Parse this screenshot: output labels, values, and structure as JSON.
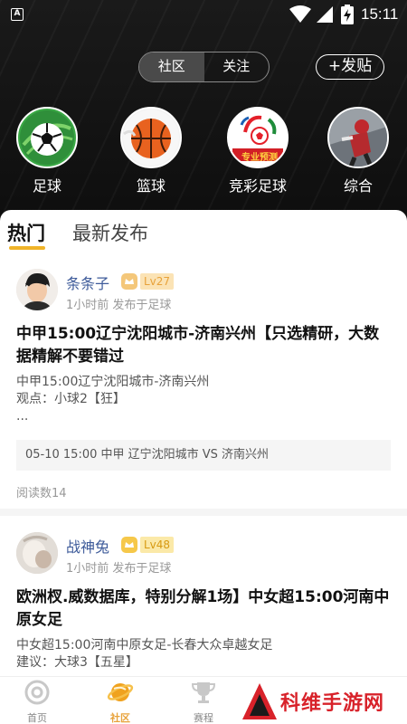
{
  "status_bar": {
    "app_icon_letter": "A",
    "time": "15:11",
    "icons": [
      "wifi-icon",
      "signal-icon",
      "battery-charging-icon"
    ]
  },
  "header": {
    "segment": {
      "tabs": [
        "社区",
        "关注"
      ],
      "active_index": 0
    },
    "post_button_label": "+发贴",
    "categories": [
      {
        "label": "足球",
        "icon": "football-icon"
      },
      {
        "label": "篮球",
        "icon": "basketball-icon"
      },
      {
        "label": "竞彩足球",
        "icon": "lottery-football-icon",
        "image_text": "专业预测"
      },
      {
        "label": "综合",
        "icon": "general-sports-icon"
      }
    ]
  },
  "feed": {
    "tabs": [
      "热门",
      "最新发布"
    ],
    "active_tab_index": 0,
    "posts": [
      {
        "author": "条条子",
        "level": "Lv27",
        "time": "1小时前 发布于足球",
        "title": "中甲15:00辽宁沈阳城市-济南兴州【只选精研，大数据精解不要错过",
        "body_lines": [
          "中甲15:00辽宁沈阳城市-济南兴州",
          "观点：小球2【狂】",
          "..."
        ],
        "match": "05-10 15:00 中甲 辽宁沈阳城市 VS 济南兴州",
        "reads": "阅读数14"
      },
      {
        "author": "战神兔",
        "level": "Lv48",
        "time": "1小时前 发布于足球",
        "title": "欧洲杈.威数据库，特别分解1场】中女超15:00河南中原女足",
        "body_lines": [
          "中女超15:00河南中原女足-长春大众卓越女足",
          "建议：大球3【五星】"
        ]
      }
    ]
  },
  "bottom_nav": {
    "items": [
      {
        "label": "首页",
        "icon": "home-icon"
      },
      {
        "label": "社区",
        "icon": "planet-icon",
        "active": true
      },
      {
        "label": "赛程",
        "icon": "trophy-icon"
      }
    ]
  },
  "watermark": {
    "text": "科维手游网"
  },
  "colors": {
    "accent": "#f0b429",
    "author_blue": "#3e5b9a",
    "watermark_red": "#d8222a"
  }
}
